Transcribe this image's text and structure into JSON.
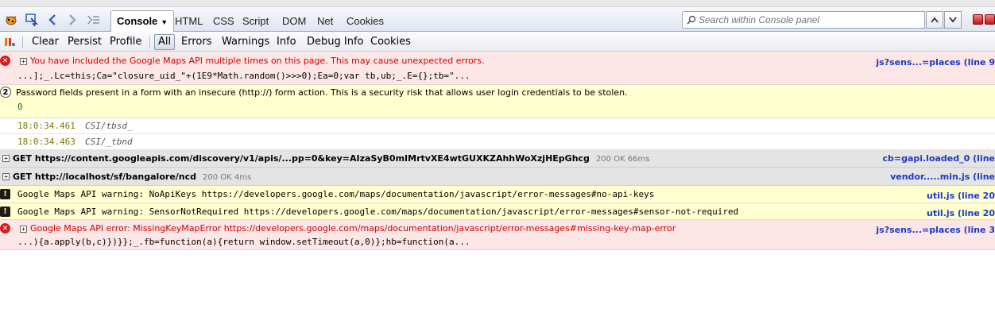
{
  "tabs": {
    "console": "Console",
    "html": "HTML",
    "css": "CSS",
    "script": "Script",
    "dom": "DOM",
    "net": "Net",
    "cookies": "Cookies"
  },
  "search": {
    "placeholder": "Search within Console panel"
  },
  "toolbar": {
    "clear": "Clear",
    "persist": "Persist",
    "profile": "Profile",
    "all": "All",
    "errors": "Errors",
    "warnings": "Warnings",
    "info": "Info",
    "debug_info": "Debug Info",
    "cookies": "Cookies"
  },
  "log": {
    "entry1": {
      "message": "You have included the Google Maps API multiple times on this page. This may cause unexpected errors.",
      "code": "...];_.Lc=this;Ca=\"closure_uid_\"+(1E9*Math.random()>>>0);Ea=0;var tb,ub;_.E={};tb=\"...",
      "source": "js?sens...=places (line 9"
    },
    "entry2": {
      "count": "2",
      "message": "Password fields present in a form with an insecure (http://) form action. This is a security risk that allows user login credentials to be stolen.",
      "value": "0"
    },
    "entry3": {
      "time": "18:0:34.461",
      "label": "CSI/tbsd_"
    },
    "entry4": {
      "time": "18:0:34.463",
      "label": "CSI/_tbnd"
    },
    "entry5": {
      "request": "GET https://content.googleapis.com/discovery/v1/apis/...pp=0&key=AIzaSyB0mIMrtvXE4wtGUXKZAhhWoXzjHEpGhcg",
      "status": "200 OK 66ms",
      "source": "cb=gapi.loaded_0 (line"
    },
    "entry6": {
      "request": "GET http://localhost/sf/bangalore/ncd",
      "status": "200 OK 4ms",
      "source": "vendor.....min.js (line"
    },
    "entry7": {
      "message": "Google Maps API warning: NoApiKeys https://developers.google.com/maps/documentation/javascript/error-messages#no-api-keys",
      "source": "util.js (line 20"
    },
    "entry8": {
      "message": "Google Maps API warning: SensorNotRequired https://developers.google.com/maps/documentation/javascript/error-messages#sensor-not-required",
      "source": "util.js (line 20"
    },
    "entry9": {
      "message": "Google Maps API error: MissingKeyMapError https://developers.google.com/maps/documentation/javascript/error-messages#missing-key-map-error",
      "code": "...){a.apply(b,c)})}};_.fb=function(a){return window.setTimeout(a,0)};hb=function(a...",
      "source": "js?sens...=places (line 3"
    }
  }
}
